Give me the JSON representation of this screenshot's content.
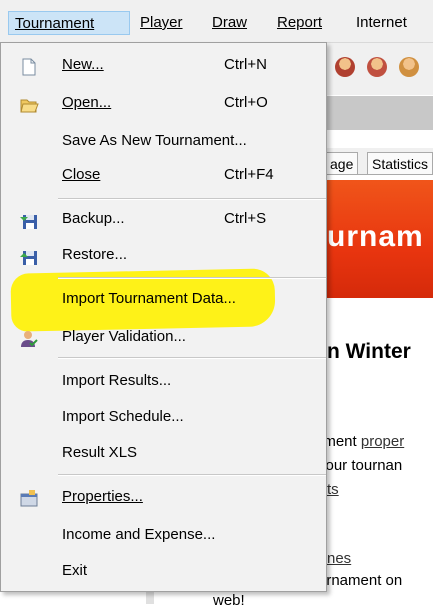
{
  "menubar": {
    "items": [
      {
        "label": "Tournament",
        "active": true
      },
      {
        "label": "Player"
      },
      {
        "label": "Draw"
      },
      {
        "label": "Report"
      },
      {
        "label": "Internet"
      }
    ]
  },
  "background": {
    "tabs": [
      "age",
      "Statistics"
    ],
    "banner_text": "urnam",
    "heading": "n Winter",
    "lines": [
      {
        "pre": "ament ",
        "link": "proper"
      },
      {
        "pre": "your tournan",
        "link": ""
      },
      {
        "pre": "",
        "link": "ts"
      },
      {
        "pre": "",
        "link": "nes"
      },
      {
        "pre": "urnament on",
        "link": ""
      },
      {
        "pre": "web!",
        "link": ""
      }
    ]
  },
  "menu": {
    "items": [
      {
        "label": "New...",
        "shortcut": "Ctrl+N",
        "icon": "new-document-icon"
      },
      {
        "label": "Open...",
        "shortcut": "Ctrl+O",
        "icon": "open-folder-icon"
      },
      {
        "label": "Save As New Tournament...",
        "shortcut": ""
      },
      {
        "label": "Close",
        "shortcut": "Ctrl+F4"
      },
      {
        "label": "Backup...",
        "shortcut": "Ctrl+S",
        "icon": "backup-floppy-icon"
      },
      {
        "label": "Restore...",
        "shortcut": "",
        "icon": "restore-floppy-icon"
      },
      {
        "label": "Import Tournament Data...",
        "shortcut": ""
      },
      {
        "label": "Player Validation...",
        "shortcut": "",
        "icon": "player-check-icon"
      },
      {
        "label": "Import Results...",
        "shortcut": ""
      },
      {
        "label": "Import Schedule...",
        "shortcut": ""
      },
      {
        "label": "Result XLS",
        "shortcut": ""
      },
      {
        "label": "Properties...",
        "shortcut": "",
        "icon": "properties-icon"
      },
      {
        "label": "Income and Expense...",
        "shortcut": ""
      },
      {
        "label": "Exit",
        "shortcut": ""
      }
    ]
  },
  "colors": {
    "highlight": "#fff200",
    "banner": "#e8350f",
    "menu_active": "#cce4f7"
  }
}
